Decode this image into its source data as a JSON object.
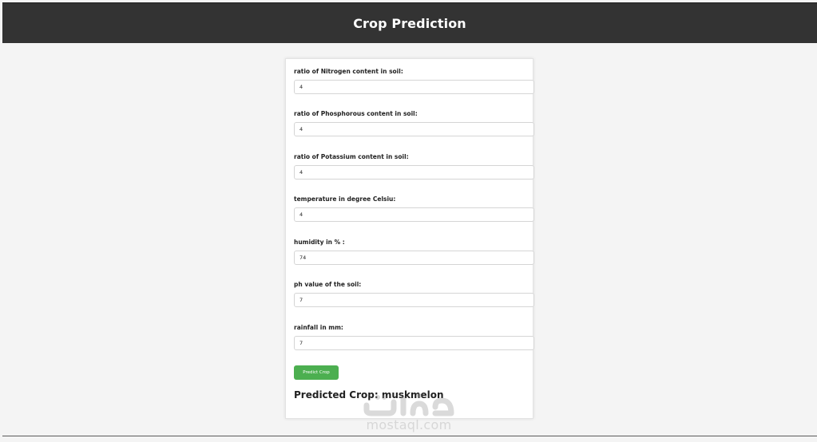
{
  "header": {
    "title": "Crop Prediction"
  },
  "form": {
    "fields": [
      {
        "label": "ratio of Nitrogen content in soil:",
        "value": "4"
      },
      {
        "label": "ratio of Phosphorous content in soil:",
        "value": "4"
      },
      {
        "label": "ratio of Potassium content in soil:",
        "value": "4"
      },
      {
        "label": "temperature in degree Celsiu:",
        "value": "4"
      },
      {
        "label": "humidity in % :",
        "value": "74"
      },
      {
        "label": "ph value of the soil:",
        "value": "7"
      },
      {
        "label": "rainfall in mm:",
        "value": "7"
      }
    ],
    "submit_label": "Predict Crop"
  },
  "result": {
    "text": "Predicted Crop: muskmelon"
  },
  "watermark": {
    "text": "mostaql.com",
    "logo_text": "مستقل"
  },
  "colors": {
    "header_bg": "#333333",
    "page_bg": "#f4f4f4",
    "button_bg": "#4caf50"
  }
}
